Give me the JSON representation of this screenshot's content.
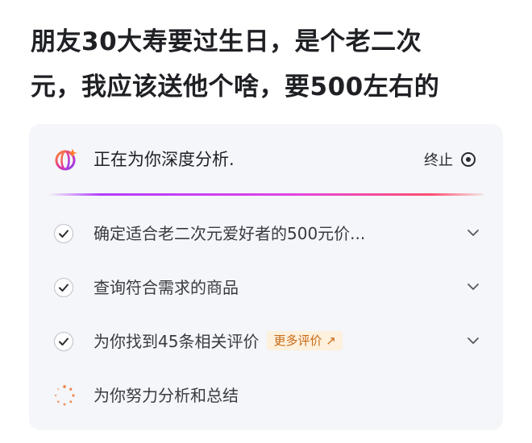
{
  "question": {
    "line1": "朋友30大寿要过生日，是个老二次",
    "line2": "元，我应该送他个啥，要500左右的"
  },
  "analysis": {
    "status": "正在为你深度分析.",
    "stop_label": "终止",
    "steps": [
      {
        "label": "确定适合老二次元爱好者的500元价...",
        "state": "done"
      },
      {
        "label": "查询符合需求的商品",
        "state": "done"
      },
      {
        "label": "为你找到45条相关评价",
        "state": "done",
        "badge": "更多评价 ↗"
      },
      {
        "label": "为你努力分析和总结",
        "state": "in-progress"
      }
    ]
  },
  "colors": {
    "accent_gradient_start": "#b33cff",
    "accent_gradient_mid": "#e043e6",
    "accent_gradient_end": "#ff4f6e",
    "badge_text": "#c86a16",
    "badge_bg": "#fdf0dc",
    "spinner": "#f07a3a"
  },
  "icons": {
    "logo": "globe-logo-icon",
    "stop": "stop-circle-icon",
    "done": "check-circle-icon",
    "expand": "chevron-down-icon",
    "loading": "spinner-icon"
  }
}
